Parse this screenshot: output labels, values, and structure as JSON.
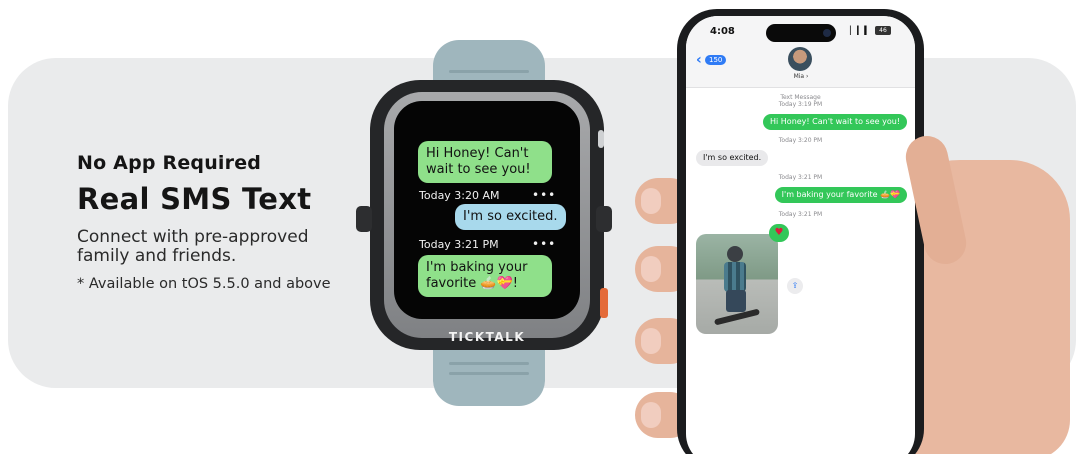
{
  "copy": {
    "eyebrow": "No App Required",
    "headline": "Real SMS Text",
    "body": "Connect with pre-approved family and friends.",
    "footnote": "* Available on tOS 5.5.0 and above"
  },
  "watch": {
    "brand": "TICKTALK",
    "messages": [
      {
        "text": "Hi Honey! Can't wait to see you!"
      },
      {
        "meta": "Today 3:20 AM"
      },
      {
        "text": "I'm so excited."
      },
      {
        "meta": "Today 3:21 PM"
      },
      {
        "text": "I'm baking your favorite 🥧💝!"
      }
    ],
    "more_icon": "•••"
  },
  "phone": {
    "time": "4:08",
    "status_icons": "▏▎▍ ◠",
    "battery": "46",
    "back_count": "150",
    "contact_name": "Mia ›",
    "messages": [
      {
        "meta_line1": "Text Message",
        "meta_line2": "Today 3:19 PM"
      },
      {
        "text": "Hi Honey! Can't wait to see you!"
      },
      {
        "meta": "Today 3:20 PM"
      },
      {
        "text": "I'm so excited."
      },
      {
        "meta": "Today 3:21 PM"
      },
      {
        "text": "I'm baking your favorite 🥧💝"
      },
      {
        "meta": "Today 3:21 PM"
      }
    ],
    "heart": "♥",
    "share": "⇪"
  },
  "colors": {
    "watch_bubble_green": "#8fe08a",
    "watch_bubble_blue": "#a8d9ec",
    "imessage_green": "#33c759",
    "ios_blue": "#2f7bf5"
  }
}
